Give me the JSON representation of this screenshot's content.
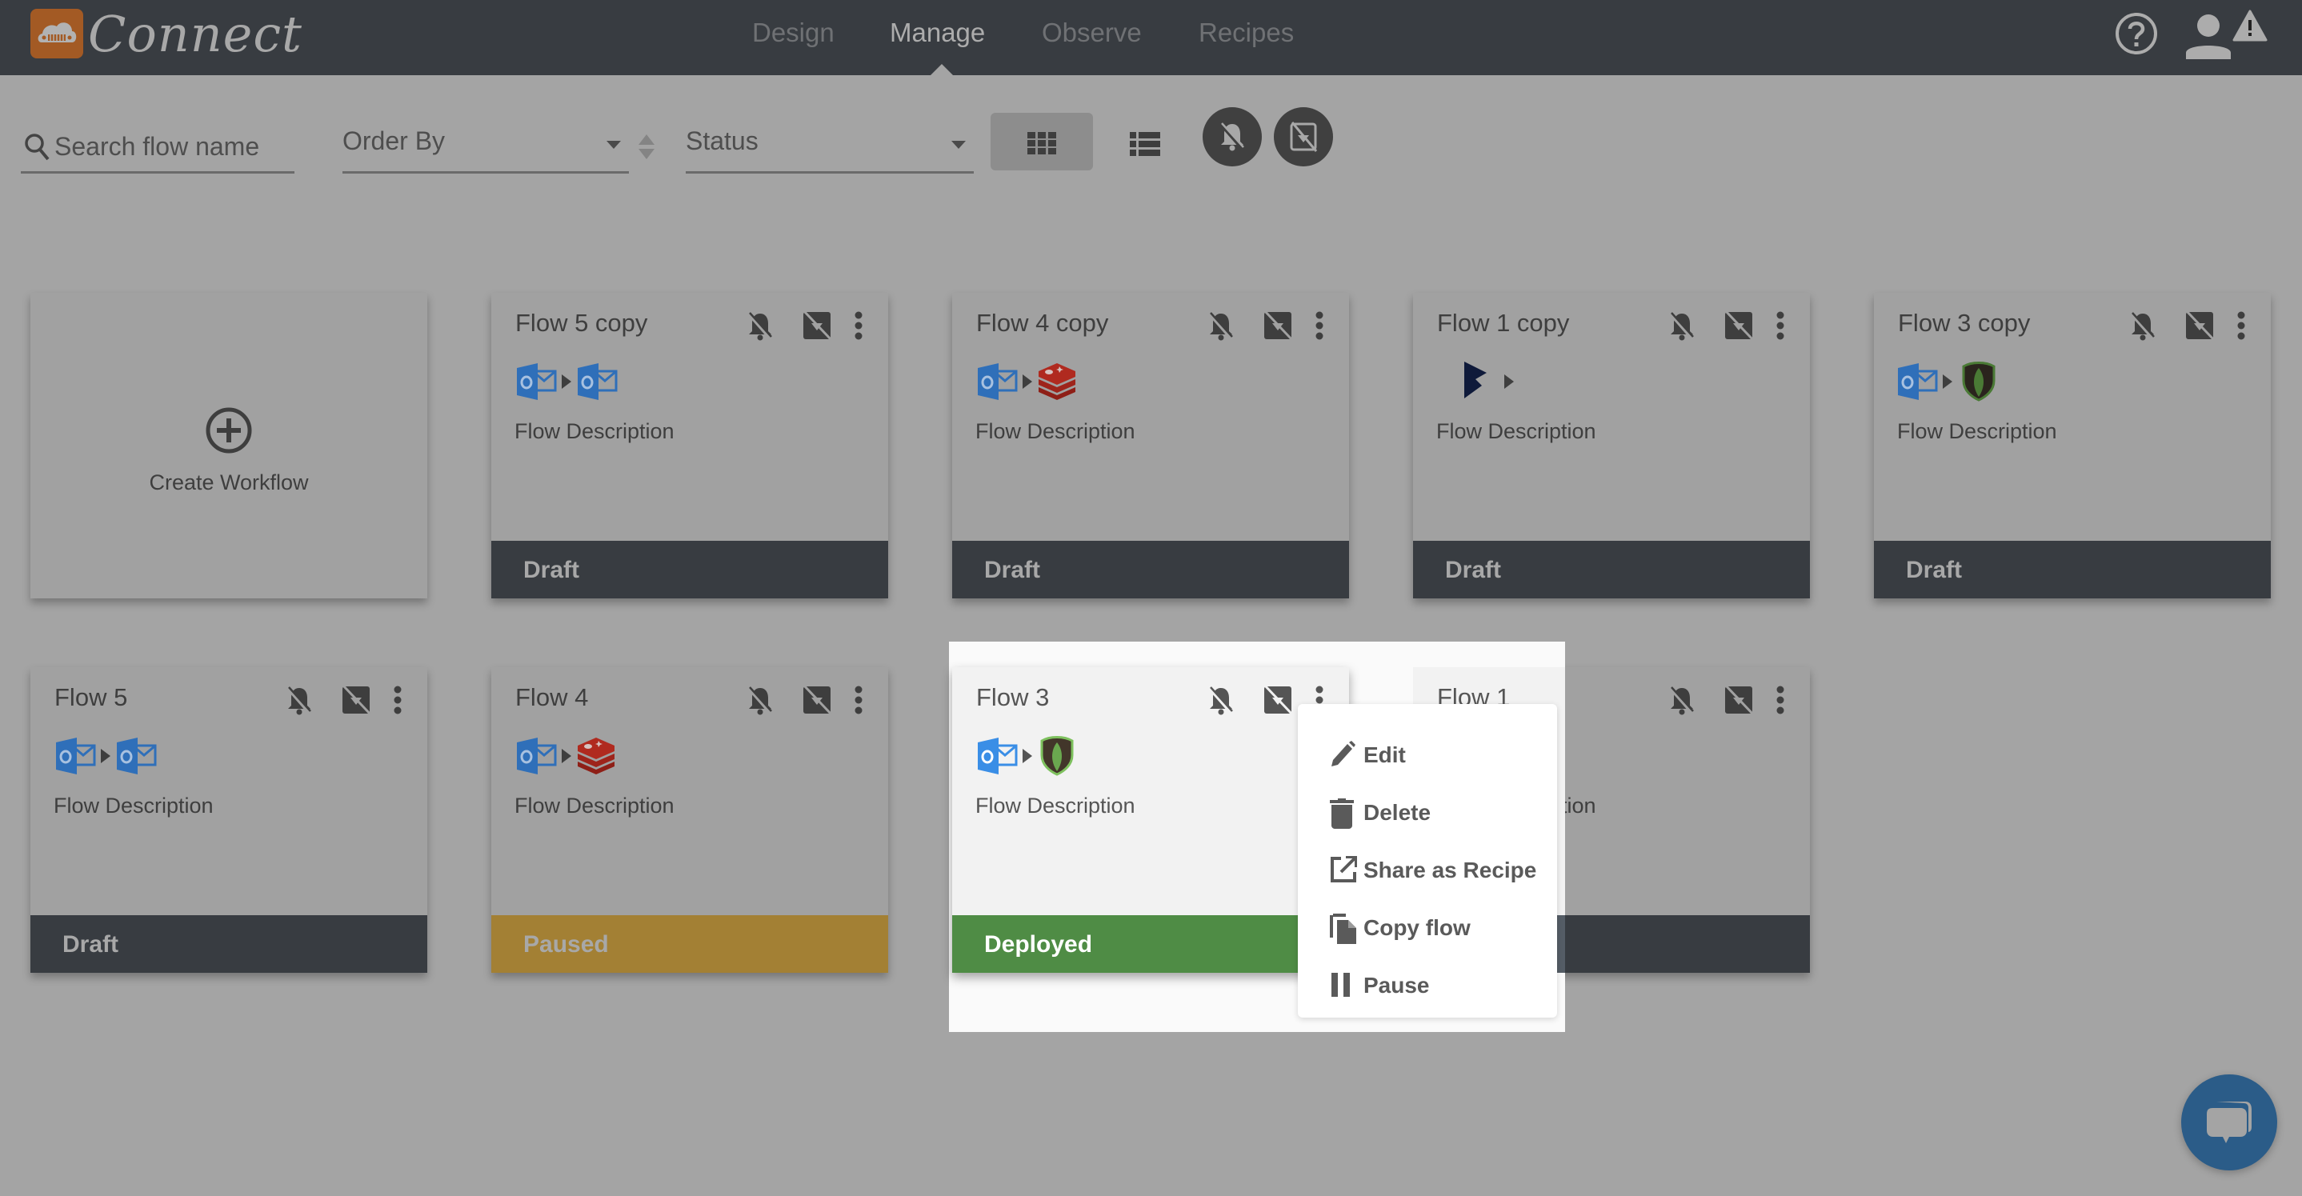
{
  "app": {
    "name": "Connect",
    "colors": {
      "header_bg": "#383c41",
      "logo_bg": "#a35a24",
      "draft": "#383c41",
      "paused": "#a38034",
      "deployed": "#4f8c45",
      "chat": "#2b5c88"
    }
  },
  "nav": {
    "items": [
      {
        "label": "Design",
        "active": false
      },
      {
        "label": "Manage",
        "active": true
      },
      {
        "label": "Observe",
        "active": false
      },
      {
        "label": "Recipes",
        "active": false
      }
    ]
  },
  "header_icons": [
    "help-circle-icon",
    "user-icon",
    "warning-icon"
  ],
  "toolbar": {
    "search_placeholder": "Search flow name",
    "search_value": "",
    "order_by_label": "Order By",
    "status_label": "Status",
    "view_modes": [
      "grid-view",
      "list-view"
    ],
    "active_view": "grid-view",
    "filter_buttons": [
      "notifications-off",
      "mute-flow"
    ]
  },
  "create_card": {
    "label": "Create Workflow"
  },
  "flows": [
    {
      "title": "Flow 5 copy",
      "icons": [
        "outlook",
        "outlook"
      ],
      "description": "Flow Description",
      "status": "Draft"
    },
    {
      "title": "Flow 4 copy",
      "icons": [
        "outlook",
        "redis"
      ],
      "description": "Flow Description",
      "status": "Draft"
    },
    {
      "title": "Flow 1 copy",
      "icons": [
        "dynamics"
      ],
      "description": "Flow Description",
      "status": "Draft"
    },
    {
      "title": "Flow 3 copy",
      "icons": [
        "outlook",
        "mongodb"
      ],
      "description": "Flow Description",
      "status": "Draft"
    },
    {
      "title": "Flow 5",
      "icons": [
        "outlook",
        "outlook"
      ],
      "description": "Flow Description",
      "status": "Draft"
    },
    {
      "title": "Flow 4",
      "icons": [
        "outlook",
        "redis"
      ],
      "description": "Flow Description",
      "status": "Paused"
    },
    {
      "title": "Flow 3",
      "icons": [
        "outlook",
        "mongodb"
      ],
      "description": "Flow Description",
      "status": "Deployed"
    },
    {
      "title": "Flow 1",
      "icons": [],
      "description": "Flow Description",
      "status": ""
    }
  ],
  "context_menu": {
    "for_flow": "Flow 3",
    "items": [
      {
        "label": "Edit",
        "icon": "pencil-icon"
      },
      {
        "label": "Delete",
        "icon": "trash-icon"
      },
      {
        "label": "Share as Recipe",
        "icon": "external-link-icon"
      },
      {
        "label": "Copy flow",
        "icon": "copy-icon"
      },
      {
        "label": "Pause",
        "icon": "pause-icon"
      }
    ]
  }
}
